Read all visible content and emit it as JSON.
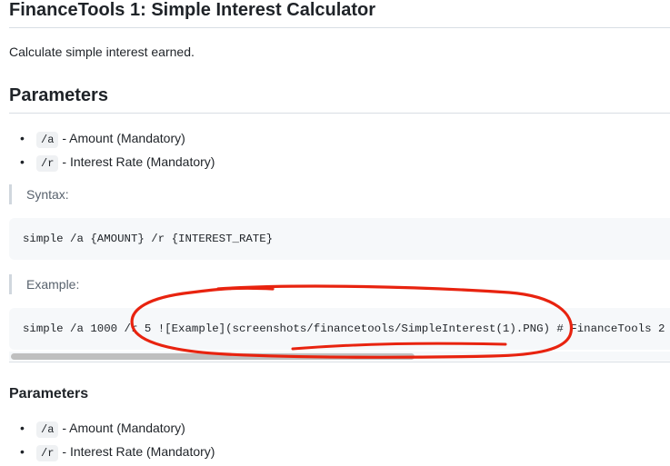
{
  "page": {
    "title": "FinanceTools 1: Simple Interest Calculator",
    "description": "Calculate simple interest earned."
  },
  "parameters_section": {
    "heading": "Parameters",
    "items": [
      {
        "flag": "/a",
        "text": "- Amount (Mandatory)"
      },
      {
        "flag": "/r",
        "text": "- Interest Rate (Mandatory)"
      }
    ]
  },
  "syntax": {
    "label": "Syntax:",
    "code": "simple /a {AMOUNT} /r {INTEREST_RATE}"
  },
  "example": {
    "label": "Example:",
    "code": "simple /a 1000 /r 5 ![Example](screenshots/financetools/SimpleInterest(1).PNG) # FinanceTools 2"
  },
  "parameters_section_2": {
    "heading": "Parameters",
    "items": [
      {
        "flag": "/a",
        "text": "- Amount (Mandatory)"
      },
      {
        "flag": "/r",
        "text": "- Interest Rate (Mandatory)"
      }
    ]
  },
  "annotation": {
    "color": "#e8230f",
    "shape": "hand-drawn-ellipse"
  },
  "colors": {
    "code_background": "#f6f8fa",
    "quote_border": "#d0d7de",
    "quote_text": "#59636e",
    "scroll_thumb": "#bfbfbf"
  }
}
